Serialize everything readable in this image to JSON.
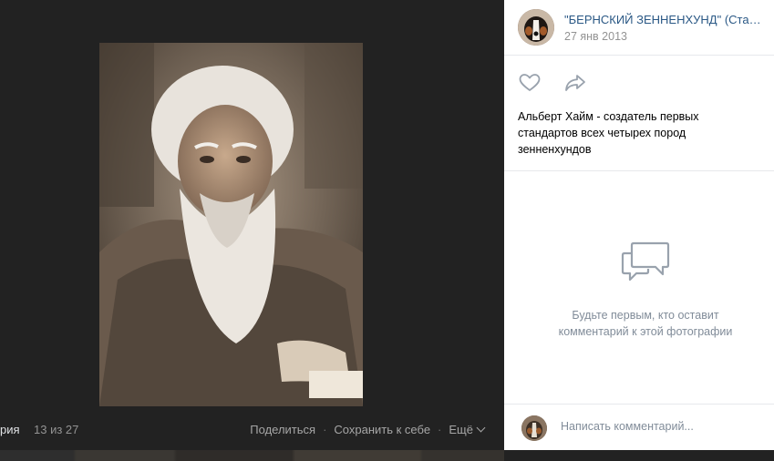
{
  "viewer": {
    "album_label": "рия",
    "counter": "13 из 27",
    "actions": {
      "share": "Поделиться",
      "save": "Сохранить к себе",
      "more": "Ещё"
    }
  },
  "panel": {
    "author": "\"БЕРНСКИЙ ЗЕННЕНХУНД\" (Стандарт породы)",
    "date": "27 янв 2013",
    "description": "Альберт Хайм - создатель первых стандартов всех четырех пород зенненхундов",
    "empty_comments": "Будьте первым, кто оставит комментарий к этой фотографии",
    "comment_placeholder": "Написать комментарий..."
  },
  "icons": {
    "like": "heart-icon",
    "share": "share-arrow-icon",
    "comments_empty": "comments-icon",
    "more_chevron": "chevron-down-icon"
  },
  "colors": {
    "viewer_bg": "#222222",
    "panel_bg": "#ffffff",
    "link": "#2a5885",
    "muted": "#939393",
    "icon": "#99a2ad"
  }
}
